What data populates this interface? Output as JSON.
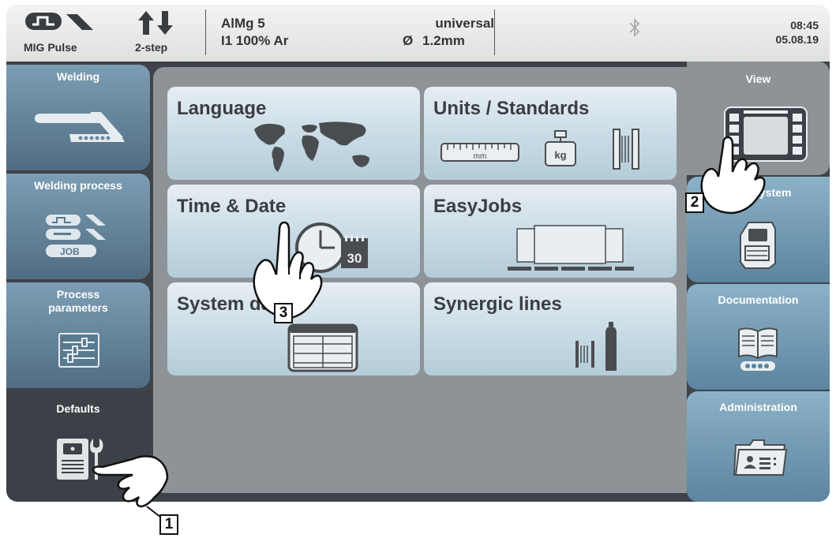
{
  "status_bar": {
    "mode": "MIG Pulse",
    "trigger": "2-step",
    "material": "AlMg 5",
    "gas": "I1 100% Ar",
    "wire_type": "universal",
    "diameter_symbol": "Ø",
    "diameter": "1.2mm",
    "time": "08:45",
    "date": "05.08.19",
    "icons": [
      "mig-pulse-icon",
      "trigger-arrows-icon",
      "bluetooth-icon"
    ]
  },
  "left_nav": {
    "items": [
      {
        "label": "Welding",
        "icon": "welding-torch-icon"
      },
      {
        "label": "Welding process",
        "icon": "process-job-icon"
      },
      {
        "label": "Process\nparameters",
        "icon": "sliders-icon"
      },
      {
        "label": "Defaults",
        "icon": "machine-wrench-icon",
        "active": true
      }
    ]
  },
  "tiles": [
    {
      "label": "Language",
      "icon": "world-map-icon"
    },
    {
      "label": "Units / Standards",
      "icon": "ruler-weight-spool-icon",
      "ruler_unit": "mm",
      "weight_unit": "kg"
    },
    {
      "label": "Time & Date",
      "icon": "clock-calendar-icon",
      "calendar_day": "30"
    },
    {
      "label": "EasyJobs",
      "icon": "easyjobs-icon"
    },
    {
      "label": "System data",
      "icon": "data-table-icon"
    },
    {
      "label": "Synergic lines",
      "icon": "spool-gas-icon"
    }
  ],
  "right_nav": {
    "items": [
      {
        "label": "View",
        "icon": "display-icon",
        "active": true
      },
      {
        "label": "System",
        "icon": "power-source-icon"
      },
      {
        "label": "Documentation",
        "icon": "book-icon"
      },
      {
        "label": "Administration",
        "icon": "folder-id-icon"
      }
    ]
  },
  "callouts": [
    "1",
    "2",
    "3"
  ],
  "colors": {
    "nav_blue": "#5d84a0",
    "tile_light": "#c8dbe5",
    "dark_panel": "#3e4349",
    "content_gray": "#8e9397"
  }
}
